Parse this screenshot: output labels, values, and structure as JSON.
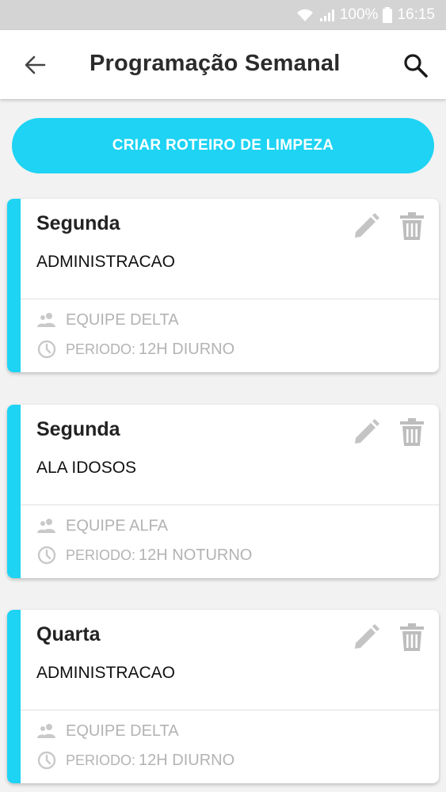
{
  "status_bar": {
    "battery": "100%",
    "time": "16:15"
  },
  "app_bar": {
    "title": "Programação Semanal"
  },
  "cta": {
    "label": "CRIAR ROTEIRO DE LIMPEZA"
  },
  "cards": [
    {
      "day": "Segunda",
      "area": "ADMINISTRACAO",
      "team": "EQUIPE DELTA",
      "period_label": "PERIODO:",
      "period_value": "12H DIURNO"
    },
    {
      "day": "Segunda",
      "area": "ALA IDOSOS",
      "team": "EQUIPE ALFA",
      "period_label": "PERIODO:",
      "period_value": "12H NOTURNO"
    },
    {
      "day": "Quarta",
      "area": "ADMINISTRACAO",
      "team": "EQUIPE DELTA",
      "period_label": "PERIODO:",
      "period_value": "12H DIURNO"
    }
  ],
  "colors": {
    "accent": "#1ed3f3",
    "muted": "#b3b3b3"
  },
  "icons": {
    "back": "arrow-left-icon",
    "search": "search-icon",
    "edit": "pencil-icon",
    "delete": "trash-icon",
    "team": "people-icon",
    "period": "clock-icon",
    "wifi": "wifi-icon",
    "signal": "signal-icon",
    "battery": "battery-icon"
  }
}
